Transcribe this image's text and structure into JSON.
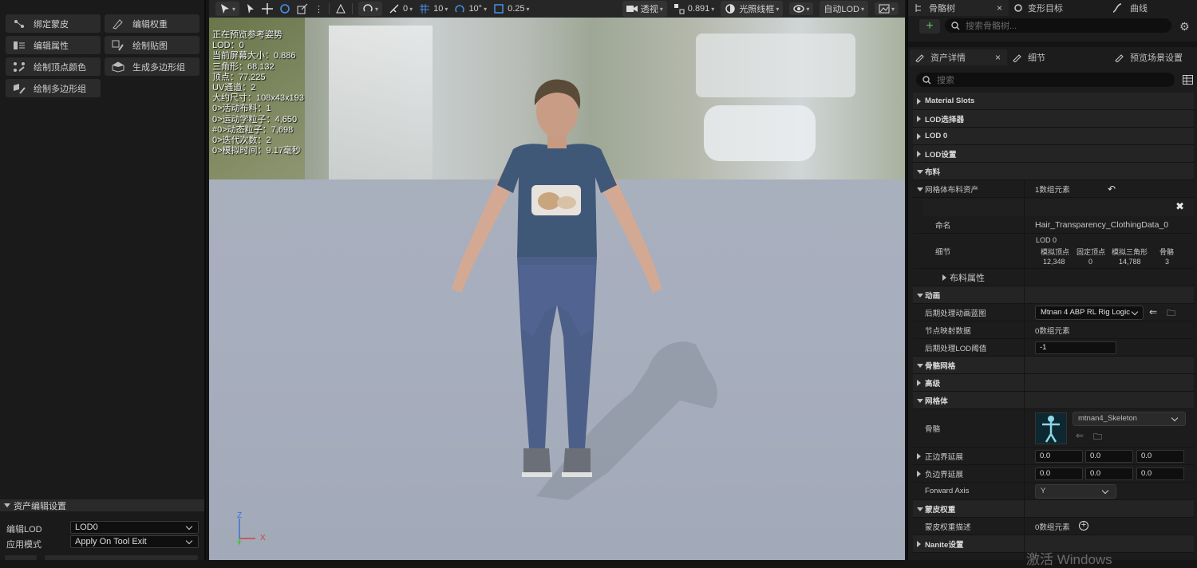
{
  "left_panel": {
    "tools": [
      {
        "label": "绑定蒙皮"
      },
      {
        "label": "编辑权重"
      },
      {
        "label": "编辑属性"
      },
      {
        "label": "绘制贴图"
      },
      {
        "label": "绘制顶点颜色"
      },
      {
        "label": "生成多边形组"
      },
      {
        "label": "绘制多边形组"
      }
    ],
    "settings": {
      "title": "资产编辑设置",
      "edit_lod_label": "编辑LOD",
      "edit_lod_value": "LOD0",
      "apply_mode_label": "应用模式",
      "apply_mode_value": "Apply On Tool Exit"
    }
  },
  "viewport": {
    "toolbar": {
      "angle_snap": "0",
      "grid_snap": "10",
      "rot_snap": "10°",
      "scale_snap": "0.25",
      "view_mode": "透视",
      "screen_size": "0.891",
      "lighting": "光照线框",
      "lod": "自动LOD"
    },
    "stats": [
      "正在预览参考姿势",
      "LOD：0",
      "当前屏幕大小：0.886",
      "三角形：68,132",
      "顶点：77,225",
      "UV通道：2",
      "大约尺寸：108x43x193",
      "0>活动布料：1",
      "0>运动学粒子：4,650",
      "#0>动态粒子：7,698",
      "0>迭代次数：2",
      "0>模拟时间：9.17毫秒"
    ],
    "axis": {
      "z": "Z",
      "x": "X",
      "y": "Y"
    }
  },
  "right_panel": {
    "top_tabs": [
      "骨骼树",
      "变形目标",
      "曲线"
    ],
    "skeleton_search_placeholder": "搜索骨骼树...",
    "detail_tabs": [
      "资产详情",
      "细节",
      "预览场景设置"
    ],
    "details_search_placeholder": "搜索",
    "categories": {
      "material_slots": "Material Slots",
      "lod_picker": "LOD选择器",
      "lod0": "LOD 0",
      "lod_settings": "LOD设置",
      "clothing": "布料",
      "animation": "动画",
      "skeletal_mesh": "骨骼网格",
      "advanced": "高级",
      "mesh": "网格体",
      "skin_weights": "蒙皮权重",
      "nanite": "Nanite设置"
    },
    "clothing": {
      "asset_label": "网格体布料资产",
      "asset_value": "1数组元素",
      "name_label": "命名",
      "name_value": "Hair_Transparency_ClothingData_0",
      "detail_label": "细节",
      "lod": "LOD 0",
      "cols": [
        "模拟顶点",
        "固定顶点",
        "模拟三角形",
        "骨骼"
      ],
      "values": [
        "12,348",
        "0",
        "14,788",
        "3"
      ],
      "props_label": "布料属性"
    },
    "animation": {
      "post_anim_bp_label": "后期处理动画蓝图",
      "post_anim_bp_value": "Mtnan 4 ABP RL Rig Logic",
      "node_map_label": "节点映射数据",
      "node_map_value": "0数组元素",
      "post_lod_label": "后期处理LOD阈值",
      "post_lod_value": "-1"
    },
    "mesh": {
      "skeleton_label": "骨骼",
      "skeleton_value": "mtnan4_Skeleton",
      "pos_bounds_label": "正边界延展",
      "pos_bounds": [
        "0.0",
        "0.0",
        "0.0"
      ],
      "neg_bounds_label": "负边界延展",
      "neg_bounds": [
        "0.0",
        "0.0",
        "0.0"
      ],
      "forward_axis_label": "Forward Axis",
      "forward_axis_value": "Y"
    },
    "skin_weights": {
      "label": "蒙皮权重描述",
      "value": "0数组元素"
    },
    "watermark": "激活 Windows"
  }
}
